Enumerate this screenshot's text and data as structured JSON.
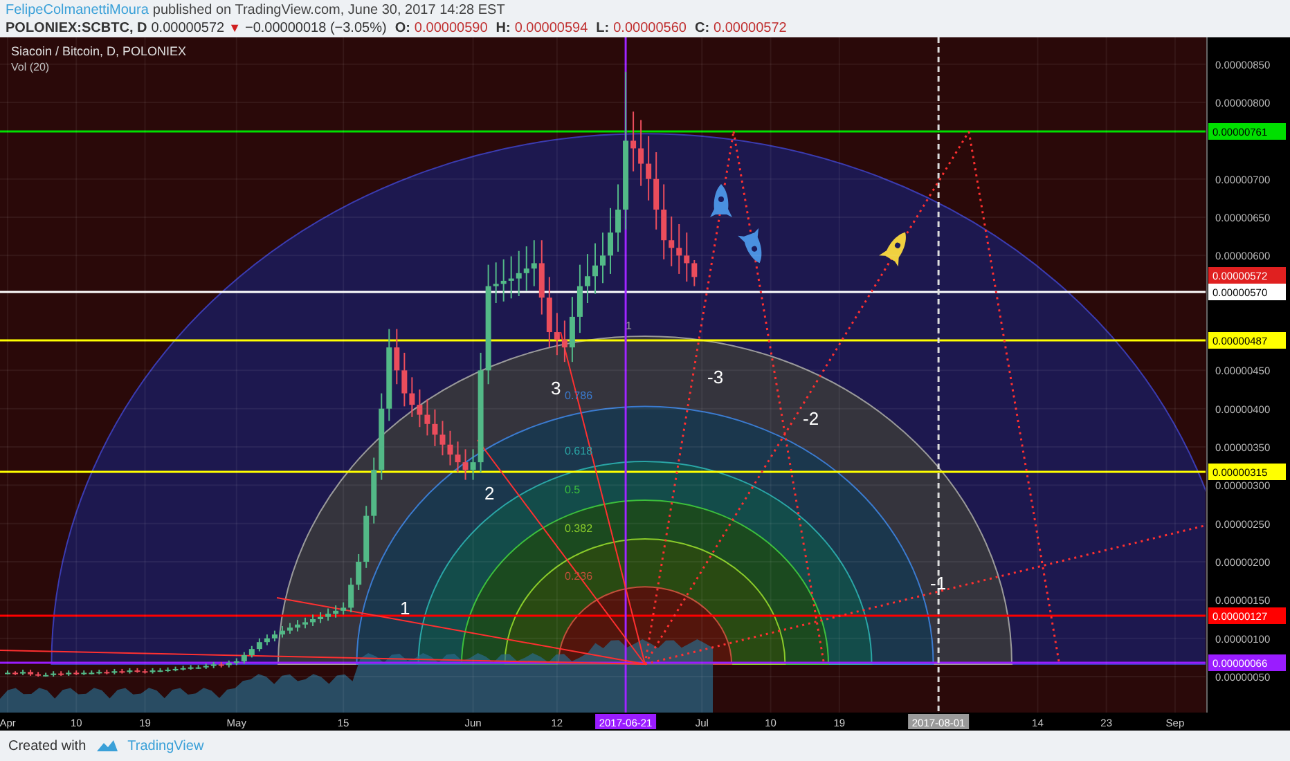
{
  "header": {
    "author": "FelipeColmanettiMoura",
    "published": "published on TradingView.com, June 30, 2017 14:28 EST"
  },
  "quote": {
    "symbol": "POLONIEX:SCBTC, D",
    "last": "0.00000572",
    "direction": "▼",
    "change": "−0.00000018 (−3.05%)",
    "ohlc": [
      {
        "label": "O:",
        "value": "0.00000590"
      },
      {
        "label": "H:",
        "value": "0.00000594"
      },
      {
        "label": "L:",
        "value": "0.00000560"
      },
      {
        "label": "C:",
        "value": "0.00000572"
      }
    ]
  },
  "chart": {
    "title": "Siacoin / Bitcoin, D, POLONIEX",
    "volume_legend": "Vol (20)",
    "chart_data": {
      "type": "candlestick",
      "x": [
        "2017-04-01",
        "2017-04-02",
        "2017-04-03",
        "2017-04-04",
        "2017-04-05",
        "2017-04-06",
        "2017-04-07",
        "2017-04-08",
        "2017-04-09",
        "2017-04-10",
        "2017-04-11",
        "2017-04-12",
        "2017-04-13",
        "2017-04-14",
        "2017-04-15",
        "2017-04-16",
        "2017-04-17",
        "2017-04-18",
        "2017-04-19",
        "2017-04-20",
        "2017-04-21",
        "2017-04-22",
        "2017-04-23",
        "2017-04-24",
        "2017-04-25",
        "2017-04-26",
        "2017-04-27",
        "2017-04-28",
        "2017-04-29",
        "2017-04-30",
        "2017-05-01",
        "2017-05-02",
        "2017-05-03",
        "2017-05-04",
        "2017-05-05",
        "2017-05-06",
        "2017-05-07",
        "2017-05-08",
        "2017-05-09",
        "2017-05-10",
        "2017-05-11",
        "2017-05-12",
        "2017-05-13",
        "2017-05-14",
        "2017-05-15",
        "2017-05-16",
        "2017-05-17",
        "2017-05-18",
        "2017-05-19",
        "2017-05-20",
        "2017-05-21",
        "2017-05-22",
        "2017-05-23",
        "2017-05-24",
        "2017-05-25",
        "2017-05-26",
        "2017-05-27",
        "2017-05-28",
        "2017-05-29",
        "2017-05-30",
        "2017-05-31",
        "2017-06-01",
        "2017-06-02",
        "2017-06-03",
        "2017-06-04",
        "2017-06-05",
        "2017-06-06",
        "2017-06-07",
        "2017-06-08",
        "2017-06-09",
        "2017-06-10",
        "2017-06-11",
        "2017-06-12",
        "2017-06-13",
        "2017-06-14",
        "2017-06-15",
        "2017-06-16",
        "2017-06-17",
        "2017-06-18",
        "2017-06-19",
        "2017-06-20",
        "2017-06-21",
        "2017-06-22",
        "2017-06-23",
        "2017-06-24",
        "2017-06-25",
        "2017-06-26",
        "2017-06-27",
        "2017-06-28",
        "2017-06-29",
        "2017-06-30"
      ],
      "xlim": [
        "2017-03-31",
        "2017-09-05"
      ],
      "xticks": [
        {
          "value": "2017-04-01",
          "label": "Apr"
        },
        {
          "value": "2017-04-10",
          "label": "10"
        },
        {
          "value": "2017-04-19",
          "label": "19"
        },
        {
          "value": "2017-05-01",
          "label": "May"
        },
        {
          "value": "2017-05-15",
          "label": "15"
        },
        {
          "value": "2017-06-01",
          "label": "Jun"
        },
        {
          "value": "2017-06-12",
          "label": "12"
        },
        {
          "value": "2017-06-21",
          "label": "2017-06-21"
        },
        {
          "value": "2017-07-01",
          "label": "Jul"
        },
        {
          "value": "2017-07-10",
          "label": "10"
        },
        {
          "value": "2017-07-19",
          "label": "19"
        },
        {
          "value": "2017-08-01",
          "label": "2017-08-01"
        },
        {
          "value": "2017-08-14",
          "label": "14"
        },
        {
          "value": "2017-08-23",
          "label": "23"
        },
        {
          "value": "2017-09-01",
          "label": "Sep"
        }
      ],
      "grid": true,
      "ylim": [
        3e-08,
        8.85e-06
      ],
      "yticks": [
        {
          "value": 8.5e-06,
          "label": "0.00000850"
        },
        {
          "value": 8e-06,
          "label": "0.00000800"
        },
        {
          "value": 7e-06,
          "label": "0.00000700"
        },
        {
          "value": 6.5e-06,
          "label": "0.00000650"
        },
        {
          "value": 6e-06,
          "label": "0.00000600"
        },
        {
          "value": 4.5e-06,
          "label": "0.00000450"
        },
        {
          "value": 4e-06,
          "label": "0.00000400"
        },
        {
          "value": 3.5e-06,
          "label": "0.00000350"
        },
        {
          "value": 3e-06,
          "label": "0.00000300"
        },
        {
          "value": 2.5e-06,
          "label": "0.00000250"
        },
        {
          "value": 2e-06,
          "label": "0.00000200"
        },
        {
          "value": 1.5e-06,
          "label": "0.00000150"
        },
        {
          "value": 1e-06,
          "label": "0.00000100"
        },
        {
          "value": 5e-07,
          "label": "0.00000050"
        }
      ],
      "ohlc": [
        [
          5.5e-07,
          5.8e-07,
          5.3e-07,
          5.5e-07
        ],
        [
          5.5e-07,
          5.7e-07,
          5.2e-07,
          5.4e-07
        ],
        [
          5.4e-07,
          5.9e-07,
          5.2e-07,
          5.6e-07
        ],
        [
          5.6e-07,
          5.9e-07,
          5.1e-07,
          5.3e-07
        ],
        [
          5.3e-07,
          5.6e-07,
          5e-07,
          5.2e-07
        ],
        [
          5.2e-07,
          5.5e-07,
          5e-07,
          5.2e-07
        ],
        [
          5.2e-07,
          5.7e-07,
          5e-07,
          5.4e-07
        ],
        [
          5.4e-07,
          5.7e-07,
          5.1e-07,
          5.3e-07
        ],
        [
          5.3e-07,
          5.8e-07,
          5.1e-07,
          5.5e-07
        ],
        [
          5.5e-07,
          5.8e-07,
          5.2e-07,
          5.4e-07
        ],
        [
          5.4e-07,
          5.8e-07,
          5.2e-07,
          5.5e-07
        ],
        [
          5.5e-07,
          5.8e-07,
          5.3e-07,
          5.5e-07
        ],
        [
          5.5e-07,
          5.9e-07,
          5.3e-07,
          5.6e-07
        ],
        [
          5.6e-07,
          5.9e-07,
          5.3e-07,
          5.5e-07
        ],
        [
          5.5e-07,
          6e-07,
          5.3e-07,
          5.7e-07
        ],
        [
          5.7e-07,
          6e-07,
          5.4e-07,
          5.6e-07
        ],
        [
          5.6e-07,
          6.1e-07,
          5.4e-07,
          5.8e-07
        ],
        [
          5.8e-07,
          6.1e-07,
          5.5e-07,
          5.7e-07
        ],
        [
          5.7e-07,
          6e-07,
          5.4e-07,
          5.6e-07
        ],
        [
          5.6e-07,
          6.1e-07,
          5.4e-07,
          5.8e-07
        ],
        [
          5.8e-07,
          6.1e-07,
          5.6e-07,
          5.8e-07
        ],
        [
          5.8e-07,
          6.2e-07,
          5.6e-07,
          5.9e-07
        ],
        [
          5.9e-07,
          6.3e-07,
          5.7e-07,
          6e-07
        ],
        [
          6e-07,
          6.4e-07,
          5.8e-07,
          6.1e-07
        ],
        [
          6.1e-07,
          6.5e-07,
          5.9e-07,
          6.2e-07
        ],
        [
          6.2e-07,
          6.5e-07,
          6e-07,
          6.2e-07
        ],
        [
          6.2e-07,
          6.7e-07,
          6e-07,
          6.4e-07
        ],
        [
          6.4e-07,
          6.9e-07,
          6.1e-07,
          6.6e-07
        ],
        [
          6.6e-07,
          6.9e-07,
          6.2e-07,
          6.5e-07
        ],
        [
          6.5e-07,
          7.1e-07,
          6.2e-07,
          6.8e-07
        ],
        [
          6.8e-07,
          7.4e-07,
          6.5e-07,
          7e-07
        ],
        [
          7e-07,
          8.2e-07,
          6.7e-07,
          7.8e-07
        ],
        [
          7.8e-07,
          9e-07,
          7.5e-07,
          8.6e-07
        ],
        [
          8.6e-07,
          1e-06,
          8.3e-07,
          9.5e-07
        ],
        [
          9.5e-07,
          1.05e-06,
          9.1e-07,
          1e-06
        ],
        [
          1e-06,
          1.1e-06,
          9.6e-07,
          1.05e-06
        ],
        [
          1.05e-06,
          1.16e-06,
          1.01e-06,
          1.1e-06
        ],
        [
          1.1e-06,
          1.2e-06,
          1.06e-06,
          1.14e-06
        ],
        [
          1.14e-06,
          1.24e-06,
          1.09e-06,
          1.18e-06
        ],
        [
          1.18e-06,
          1.27e-06,
          1.13e-06,
          1.21e-06
        ],
        [
          1.21e-06,
          1.31e-06,
          1.16e-06,
          1.25e-06
        ],
        [
          1.25e-06,
          1.34e-06,
          1.2e-06,
          1.28e-06
        ],
        [
          1.28e-06,
          1.39e-06,
          1.23e-06,
          1.32e-06
        ],
        [
          1.32e-06,
          1.43e-06,
          1.27e-06,
          1.36e-06
        ],
        [
          1.36e-06,
          1.47e-06,
          1.31e-06,
          1.4e-06
        ],
        [
          1.4e-06,
          1.79e-06,
          1.34e-06,
          1.7e-06
        ],
        [
          1.7e-06,
          2.1e-06,
          1.63e-06,
          2e-06
        ],
        [
          2e-06,
          2.73e-06,
          1.92e-06,
          2.6e-06
        ],
        [
          2.6e-06,
          3.36e-06,
          2.5e-06,
          3.2e-06
        ],
        [
          3.2e-06,
          4.2e-06,
          3.07e-06,
          4e-06
        ],
        [
          4e-06,
          5.04e-06,
          3.84e-06,
          4.8e-06
        ],
        [
          4.8e-06,
          5.04e-06,
          4.32e-06,
          4.5e-06
        ],
        [
          4.5e-06,
          4.73e-06,
          4.03e-06,
          4.2e-06
        ],
        [
          4.2e-06,
          4.41e-06,
          3.89e-06,
          4.05e-06
        ],
        [
          4.05e-06,
          4.25e-06,
          3.76e-06,
          3.92e-06
        ],
        [
          3.92e-06,
          4.12e-06,
          3.65e-06,
          3.8e-06
        ],
        [
          3.8e-06,
          3.99e-06,
          3.51e-06,
          3.66e-06
        ],
        [
          3.66e-06,
          3.84e-06,
          3.39e-06,
          3.53e-06
        ],
        [
          3.53e-06,
          3.71e-06,
          3.26e-06,
          3.4e-06
        ],
        [
          3.4e-06,
          3.57e-06,
          3.17e-06,
          3.3e-06
        ],
        [
          3.3e-06,
          3.47e-06,
          3.07e-06,
          3.2e-06
        ],
        [
          3.2e-06,
          3.47e-06,
          3.07e-06,
          3.3e-06
        ],
        [
          3.3e-06,
          4.73e-06,
          3.17e-06,
          4.5e-06
        ],
        [
          4.5e-06,
          5.88e-06,
          4.32e-06,
          5.6e-06
        ],
        [
          5.6e-06,
          5.91e-06,
          5.38e-06,
          5.63e-06
        ],
        [
          5.63e-06,
          5.95e-06,
          5.4e-06,
          5.67e-06
        ],
        [
          5.67e-06,
          5.99e-06,
          5.44e-06,
          5.7e-06
        ],
        [
          5.7e-06,
          6.06e-06,
          5.47e-06,
          5.77e-06
        ],
        [
          5.77e-06,
          6.12e-06,
          5.54e-06,
          5.83e-06
        ],
        [
          5.83e-06,
          6.2e-06,
          5.6e-06,
          5.9e-06
        ],
        [
          5.9e-06,
          6.2e-06,
          5.23e-06,
          5.45e-06
        ],
        [
          5.45e-06,
          5.72e-06,
          4.8e-06,
          5e-06
        ],
        [
          5e-06,
          5.25e-06,
          4.7e-06,
          4.9e-06
        ],
        [
          4.9e-06,
          5.15e-06,
          4.61e-06,
          4.8e-06
        ],
        [
          4.8e-06,
          5.46e-06,
          4.61e-06,
          5.2e-06
        ],
        [
          5.2e-06,
          5.88e-06,
          4.99e-06,
          5.6e-06
        ],
        [
          5.6e-06,
          6.02e-06,
          5.38e-06,
          5.73e-06
        ],
        [
          5.73e-06,
          6.16e-06,
          5.5e-06,
          5.87e-06
        ],
        [
          5.87e-06,
          6.3e-06,
          5.64e-06,
          6e-06
        ],
        [
          6e-06,
          6.62e-06,
          5.76e-06,
          6.3e-06
        ],
        [
          6.3e-06,
          6.93e-06,
          6.05e-06,
          6.6e-06
        ],
        [
          6.6e-06,
          8.4e-06,
          6.34e-06,
          7.5e-06
        ],
        [
          7.5e-06,
          7.88e-06,
          7.1e-06,
          7.4e-06
        ],
        [
          7.4e-06,
          7.77e-06,
          6.91e-06,
          7.2e-06
        ],
        [
          7.2e-06,
          7.56e-06,
          6.72e-06,
          7e-06
        ],
        [
          7e-06,
          7.35e-06,
          6.34e-06,
          6.6e-06
        ],
        [
          6.6e-06,
          6.93e-06,
          5.95e-06,
          6.2e-06
        ],
        [
          6.2e-06,
          6.51e-06,
          5.86e-06,
          6.1e-06
        ],
        [
          6.1e-06,
          6.41e-06,
          5.76e-06,
          6e-06
        ],
        [
          6e-06,
          6.3e-06,
          5.66e-06,
          5.9e-06
        ],
        [
          5.9e-06,
          5.94e-06,
          5.6e-06,
          5.72e-06
        ]
      ]
    },
    "price_tags": [
      {
        "value": "0.00000761",
        "color": "#00e000",
        "kind": "line"
      },
      {
        "value": "0.00000572",
        "color": "#e02020",
        "kind": "last"
      },
      {
        "value": "0.00000570",
        "color": "#ffffff",
        "kind": "line"
      },
      {
        "value": "0.00000487",
        "color": "#ffff00",
        "kind": "line"
      },
      {
        "value": "0.00000315",
        "color": "#ffff00",
        "kind": "line"
      },
      {
        "value": "0.00000127",
        "color": "#ff0000",
        "kind": "line"
      },
      {
        "value": "0.00000066",
        "color": "#9a1cff",
        "kind": "line"
      }
    ],
    "date_markers": [
      {
        "color": "#9a1cff"
      },
      {
        "color": "#9a9a9a"
      }
    ],
    "fib_levels": [
      {
        "label": "1",
        "color": "#9a9a9a"
      },
      {
        "label": "0.786",
        "color": "#3b7bd0"
      },
      {
        "label": "0.618",
        "color": "#2aa6a6"
      },
      {
        "label": "0.5",
        "color": "#3cbf3c"
      },
      {
        "label": "0.382",
        "color": "#8acb2a"
      },
      {
        "label": "0.236",
        "color": "#c0503a"
      }
    ],
    "fan_labels": [
      "1",
      "2",
      "3",
      "-3",
      "-2",
      "-1"
    ]
  },
  "footer": {
    "created_with": "Created with",
    "brand": "TradingView"
  }
}
